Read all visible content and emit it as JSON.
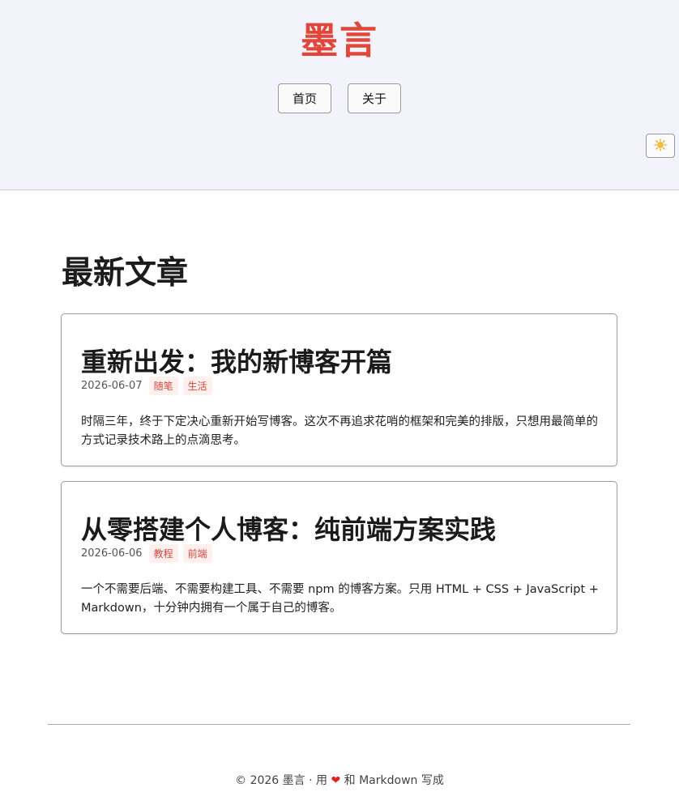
{
  "header": {
    "site_title": "墨言",
    "nav": [
      {
        "label": "首页"
      },
      {
        "label": "关于"
      }
    ],
    "theme_toggle_icon": "sun-icon"
  },
  "main": {
    "section_title": "最新文章",
    "posts": [
      {
        "title": "重新出发：我的新博客开篇",
        "date": "2026-06-07",
        "tags": [
          "随笔",
          "生活"
        ],
        "excerpt": "时隔三年，终于下定决心重新开始写博客。这次不再追求花哨的框架和完美的排版，只想用最简单的方式记录技术路上的点滴思考。"
      },
      {
        "title": "从零搭建个人博客：纯前端方案实践",
        "date": "2026-06-06",
        "tags": [
          "教程",
          "前端"
        ],
        "excerpt": "一个不需要后端、不需要构建工具、不需要 npm 的博客方案。只用 HTML + CSS + JavaScript + Markdown，十分钟内拥有一个属于自己的博客。"
      }
    ]
  },
  "footer": {
    "prefix": "© 2026 墨言 · 用 ",
    "heart": "❤",
    "suffix": " 和 Markdown 写成"
  },
  "colors": {
    "accent": "#e0463a",
    "header_bg": "#f3f3fb",
    "tag_bg": "#fdf0ef"
  }
}
